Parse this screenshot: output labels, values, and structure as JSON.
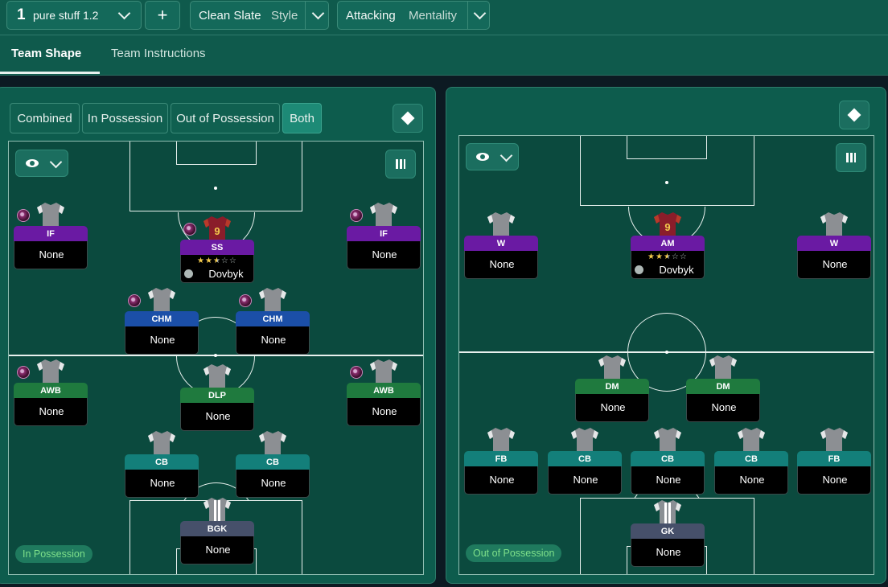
{
  "topbar": {
    "tactic_number": "1",
    "tactic_name": "pure stuff 1.2",
    "add_label": "+",
    "style_value": "Clean Slate",
    "style_label": "Style",
    "mentality_value": "Attacking",
    "mentality_label": "Mentality"
  },
  "tabs": {
    "team_shape": "Team Shape",
    "team_instructions": "Team Instructions"
  },
  "view_modes": [
    "Combined",
    "In Possession",
    "Out of Possession",
    "Both"
  ],
  "active_view_mode": "Both",
  "left_pitch": {
    "badge": "In Possession",
    "players": [
      {
        "role": "IF",
        "name": "None",
        "color": "#6a1aa3",
        "badge": true
      },
      {
        "role": "SS",
        "name": "Dovbyk",
        "stars": 2.5,
        "color": "#6a1aa3",
        "badge": true,
        "shirt_number": "9"
      },
      {
        "role": "IF",
        "name": "None",
        "color": "#6a1aa3",
        "badge": true
      },
      {
        "role": "CHM",
        "name": "None",
        "color": "#1b4fa8",
        "badge": true
      },
      {
        "role": "CHM",
        "name": "None",
        "color": "#1b4fa8",
        "badge": true
      },
      {
        "role": "AWB",
        "name": "None",
        "color": "#1f7a3e",
        "badge": true
      },
      {
        "role": "DLP",
        "name": "None",
        "color": "#1f7a3e",
        "badge": false
      },
      {
        "role": "AWB",
        "name": "None",
        "color": "#1f7a3e",
        "badge": true
      },
      {
        "role": "CB",
        "name": "None",
        "color": "#137f7a",
        "badge": false
      },
      {
        "role": "CB",
        "name": "None",
        "color": "#137f7a",
        "badge": false
      },
      {
        "role": "BGK",
        "name": "None",
        "color": "#46506a",
        "badge": false
      }
    ]
  },
  "right_pitch": {
    "badge": "Out of Possession",
    "players": [
      {
        "role": "W",
        "name": "None",
        "color": "#6a1aa3"
      },
      {
        "role": "AM",
        "name": "Dovbyk",
        "stars": 2.5,
        "color": "#6a1aa3",
        "shirt_number": "9"
      },
      {
        "role": "W",
        "name": "None",
        "color": "#6a1aa3"
      },
      {
        "role": "DM",
        "name": "None",
        "color": "#1f7a3e"
      },
      {
        "role": "DM",
        "name": "None",
        "color": "#1f7a3e"
      },
      {
        "role": "FB",
        "name": "None",
        "color": "#137f7a"
      },
      {
        "role": "CB",
        "name": "None",
        "color": "#137f7a"
      },
      {
        "role": "CB",
        "name": "None",
        "color": "#137f7a"
      },
      {
        "role": "CB",
        "name": "None",
        "color": "#137f7a"
      },
      {
        "role": "FB",
        "name": "None",
        "color": "#137f7a"
      },
      {
        "role": "GK",
        "name": "None",
        "color": "#46506a"
      }
    ]
  },
  "colors": {
    "accent": "#1d8a76",
    "pitch": "#0b4a3e",
    "in_possession_text": "#7ee08a"
  }
}
